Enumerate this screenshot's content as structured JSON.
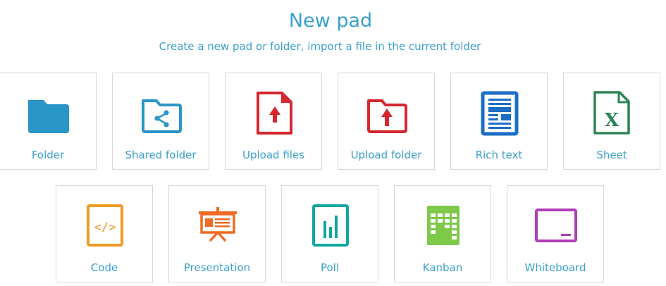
{
  "header": {
    "title": "New pad",
    "subtitle": "Create a new pad or folder, import a file in the current folder"
  },
  "tiles": [
    {
      "label": "Folder",
      "icon": "folder-icon",
      "color": "#2a95c9"
    },
    {
      "label": "Shared folder",
      "icon": "shared-folder-icon",
      "color": "#2a95c9"
    },
    {
      "label": "Upload files",
      "icon": "upload-file-icon",
      "color": "#d7262e"
    },
    {
      "label": "Upload folder",
      "icon": "upload-folder-icon",
      "color": "#d7262e"
    },
    {
      "label": "Rich text",
      "icon": "rich-text-icon",
      "color": "#1c6dc4"
    },
    {
      "label": "Sheet",
      "icon": "sheet-icon",
      "color": "#2e8456"
    },
    {
      "label": "Code",
      "icon": "code-icon",
      "color": "#f09a22"
    },
    {
      "label": "Presentation",
      "icon": "presentation-icon",
      "color": "#ee6a25"
    },
    {
      "label": "Poll",
      "icon": "poll-icon",
      "color": "#12a6a2"
    },
    {
      "label": "Kanban",
      "icon": "kanban-icon",
      "color": "#7ec84a"
    },
    {
      "label": "Whiteboard",
      "icon": "whiteboard-icon",
      "color": "#b03db8"
    }
  ]
}
